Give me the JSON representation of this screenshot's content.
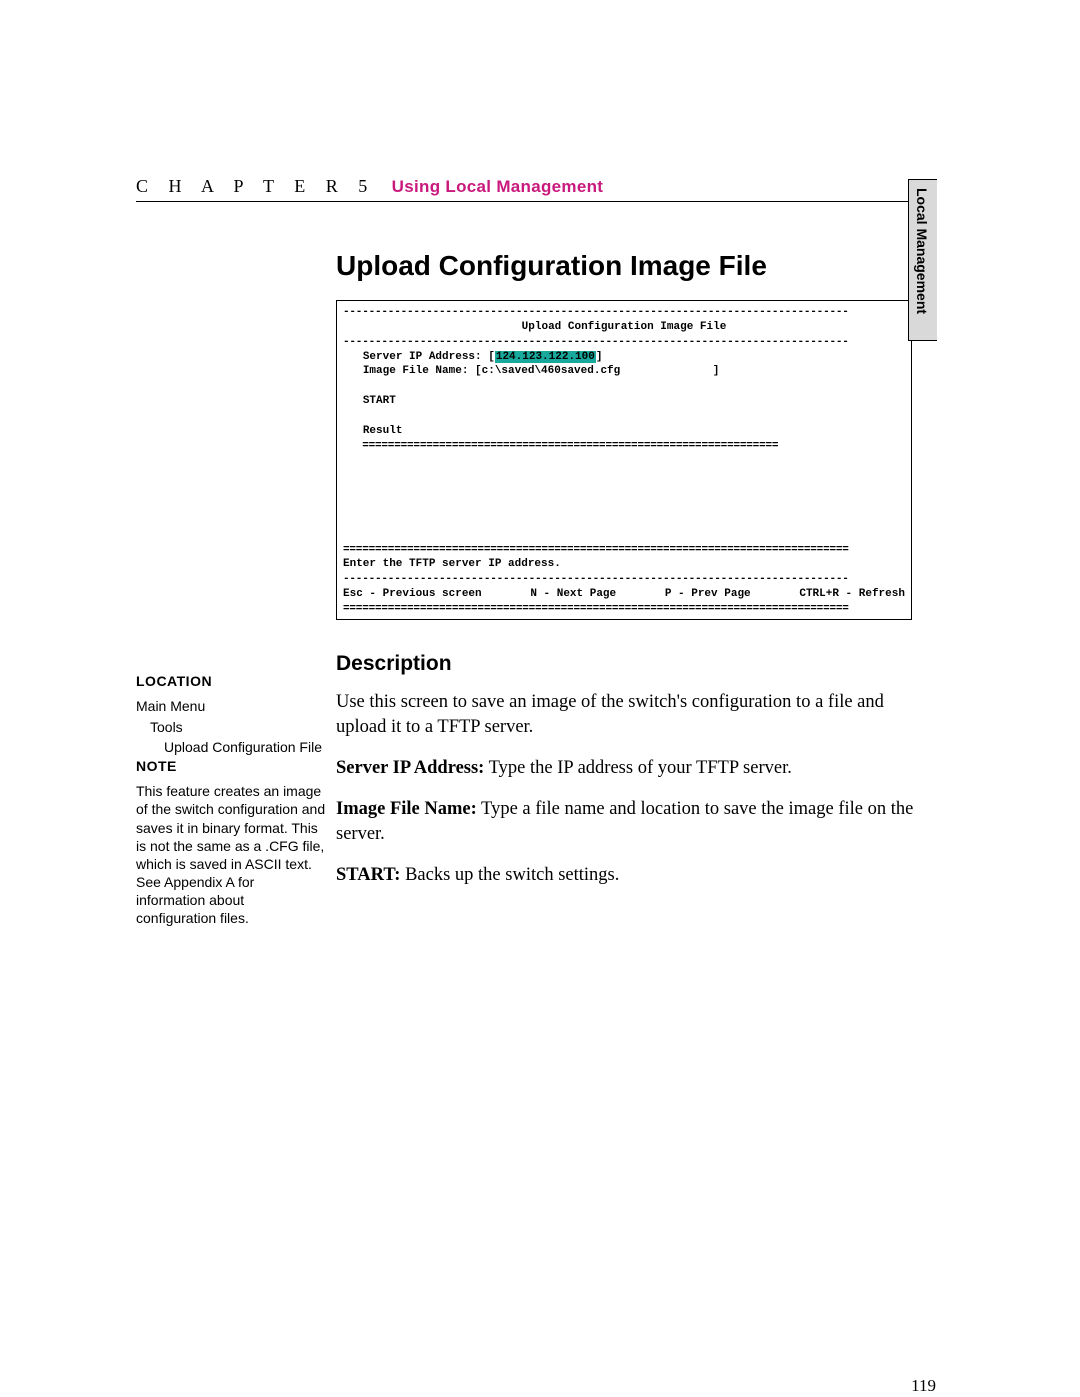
{
  "header": {
    "chapter": "C H A P T E R 5",
    "section": "Using Local Management"
  },
  "side_tab": "Local Management",
  "main_title": "Upload Configuration Image File",
  "terminal": {
    "title": "Upload Configuration Image File",
    "server_label": "Server IP Address: [",
    "server_ip": "124.123.122.100",
    "server_end": "]",
    "image_label": "Image File Name: [c:\\saved\\460saved.cfg",
    "image_end": "]",
    "start": "START",
    "result": "Result",
    "prompt": "Enter the TFTP server IP address.",
    "foot_esc": "Esc - Previous screen",
    "foot_next": "N - Next Page",
    "foot_prev": "P - Prev Page",
    "foot_refresh": "CTRL+R - Refresh"
  },
  "sidebar": {
    "location_head": "LOCATION",
    "loc1": "Main Menu",
    "loc2": "Tools",
    "loc3": "Upload Configuration File",
    "note_head": "NOTE",
    "note_body": "This feature creates an image of the switch configuration and saves it in binary format. This is not the same as a .CFG file, which is saved in ASCII text. See Appendix A for information about configuration files."
  },
  "content": {
    "desc_head": "Description",
    "p1": "Use this screen to save an image of the switch's configuration to a file and upload it to a TFTP server.",
    "p2a": "Server IP Address:",
    "p2b": " Type the IP address of your TFTP server.",
    "p3a": "Image File Name:",
    "p3b": " Type a file name and location to save the image file on the server.",
    "p4a": "START:",
    "p4b": " Backs up the switch settings."
  },
  "page_num": "119"
}
